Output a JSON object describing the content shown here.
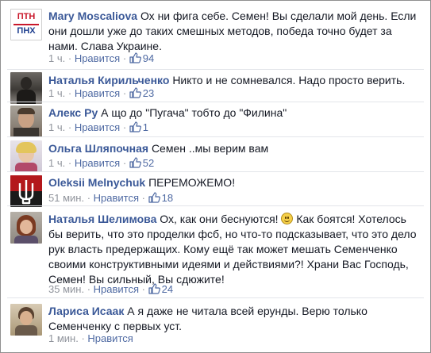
{
  "comments": [
    {
      "author": "Mary Moscaliova",
      "text": "Ох ни фига себе. Семен! Вы сделали мой день. Если они дошли уже до таких смешных методов, победа точно будет за нами. Слава Украине.",
      "time": "1 ч.",
      "like_label": "Нравится",
      "likes": "94",
      "avatar_text_top": "ПТН",
      "avatar_text_bottom": "ПНХ"
    },
    {
      "author": "Наталья Кирильченко",
      "text": "Никто и не сомневался. Надо просто верить.",
      "time": "1 ч.",
      "like_label": "Нравится",
      "likes": "23"
    },
    {
      "author": "Алекс Ру",
      "text": "А що до \"Пугача\" тобто до \"Филина\"",
      "time": "1 ч.",
      "like_label": "Нравится",
      "likes": "1"
    },
    {
      "author": "Ольга Шляпочная",
      "text": "Семен ..мы верим вам",
      "time": "1 ч.",
      "like_label": "Нравится",
      "likes": "52"
    },
    {
      "author": "Oleksii Melnychuk",
      "text": "ПЕРЕМОЖЕМО!",
      "time": "51 мин.",
      "like_label": "Нравится",
      "likes": "18"
    },
    {
      "author": "Наталья Шелимова",
      "text_before": "Ох, как они беснуются!",
      "text_after": "Как боятся! Хотелось бы верить, что это проделки фсб, но что-то подсказывает, что это дело рук власть предержащих. Кому ещё так может мешать Семенченко своими конструктивными идеями и действиями?! Храни Вас Господь, Семен! Вы сильный, Вы сдюжите!",
      "time": "35 мин.",
      "like_label": "Нравится",
      "likes": "24"
    },
    {
      "author": "Лариса Исаак",
      "text": "А я даже не читала всей ерунды. Верю только Семенченку с первых уст.",
      "time": "1 мин.",
      "like_label": "Нравится"
    }
  ],
  "colors": {
    "name": "#3b5998",
    "meta": "#90949c",
    "link": "#4e69a2"
  }
}
